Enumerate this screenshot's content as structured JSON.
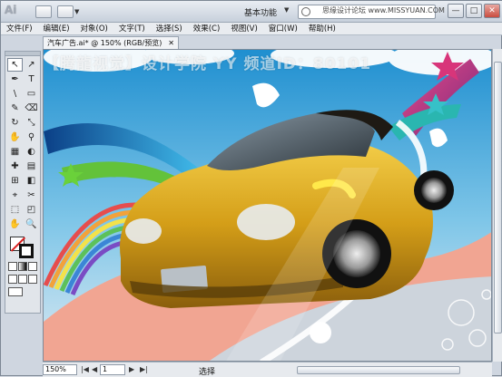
{
  "app": {
    "logo": "Ai",
    "workspace": "基本功能",
    "watermark": "思缘设计论坛 www.MISSYUAN.COM",
    "window_controls": [
      "—",
      "□",
      "✕"
    ]
  },
  "menu": [
    "文件(F)",
    "编辑(E)",
    "对象(O)",
    "文字(T)",
    "选择(S)",
    "效果(C)",
    "视图(V)",
    "窗口(W)",
    "帮助(H)"
  ],
  "document": {
    "tab_title": "汽车广告.ai* @ 150% (RGB/预览)",
    "tab_close": "✕",
    "overlay_text": "【腾龍视觉】设计学院  YY 频道ID：80101"
  },
  "tools": [
    "↖",
    "↗",
    "✒",
    "T",
    "\\",
    "▭",
    "✎",
    "⌫",
    "↻",
    "⤡",
    "✋",
    "⚲",
    "▦",
    "◐",
    "✚",
    "▤",
    "⊞",
    "◧",
    "⌖",
    "✂",
    "⬚",
    "◰",
    "✋",
    "🔍"
  ],
  "status": {
    "zoom": "150%",
    "page": "1",
    "nav_first": "|◀",
    "nav_prev": "◀",
    "nav_next": "▶",
    "nav_last": "▶|",
    "mode": "选择"
  },
  "colors": {
    "sky": "#2f9fd6",
    "car_body": "#d8a41c",
    "accent_pink": "#e0437a"
  }
}
